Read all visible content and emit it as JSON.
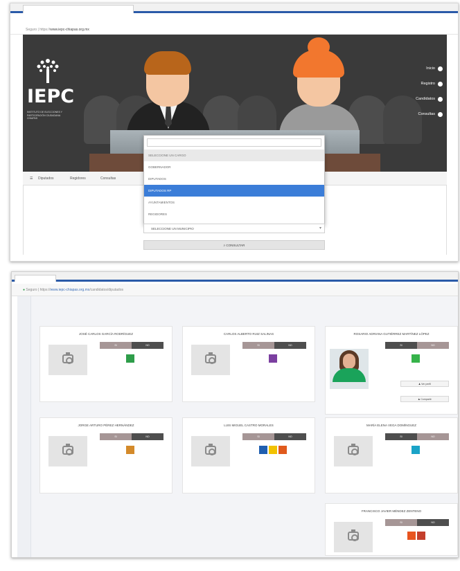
{
  "screen1": {
    "tab_title": "",
    "url": {
      "prefix": "Seguro | https://",
      "highlight": "www.iepc-chiapas.org.mx",
      "rest": ""
    },
    "logo": {
      "acronym": "IEPC",
      "subtitle": "INSTITUTO DE ELECCIONES Y PARTICIPACIÓN CIUDADANA",
      "state": "CHIAPAS"
    },
    "hero_menu": [
      "Inicio",
      "Registro",
      "Candidatos",
      "Consultas"
    ],
    "nav": [
      "Diputados",
      "Regidores",
      "Consultas"
    ],
    "dropdown": {
      "options": [
        {
          "label": "SELECCIONE UN CARGO",
          "style": "header"
        },
        {
          "label": "GOBERNADOR",
          "style": ""
        },
        {
          "label": "DIPUTADOS",
          "style": ""
        },
        {
          "label": "DIPUTADOS RP",
          "style": "selected"
        },
        {
          "label": "AYUNTAMIENTOS",
          "style": ""
        },
        {
          "label": "REGIDORES",
          "style": ""
        }
      ]
    },
    "select_municipio": "SELECCIONE UN MUNICIPIO",
    "consult_button": "CONSULTAR"
  },
  "screen2": {
    "url": {
      "prefix": "Seguro | https://",
      "highlight": "www.iepc-chiapas.org.mx",
      "rest": "/candidatos/diputados"
    },
    "vote_yes": "SI",
    "vote_no": "NO",
    "cards": [
      {
        "name": "JOSÉ CARLOS GARCÍA RODRÍGUEZ",
        "photo": "camera",
        "vote_style": "",
        "party_colors": [
          "#2e9d4a"
        ],
        "actions": []
      },
      {
        "name": "CARLOS ALBERTO RUIZ SALINAS",
        "photo": "camera",
        "vote_style": "",
        "party_colors": [
          "#7b3fa0"
        ],
        "actions": []
      },
      {
        "name": "ROSARIO ADRIANA GUTIÉRREZ MARTÍNEZ LÓPEZ",
        "photo": "person",
        "vote_style": "alt",
        "party_colors": [
          "#36b34a"
        ],
        "actions": [
          "Ver perfil",
          "Compartir"
        ]
      },
      {
        "name": "JORGE ARTURO PÉREZ HERNÁNDEZ",
        "photo": "camera",
        "vote_style": "",
        "party_colors": [
          "#d48a2a"
        ],
        "actions": []
      },
      {
        "name": "LUIS MIGUEL CASTRO MORALES",
        "photo": "camera",
        "vote_style": "",
        "party_colors": [
          "#1f5fb0",
          "#f2c200",
          "#e05a1c"
        ],
        "actions": []
      },
      {
        "name": "MARÍA ELENA VEGA DOMÍNGUEZ",
        "photo": "camera",
        "vote_style": "alt",
        "party_colors": [
          "#1aa3c7"
        ],
        "actions": []
      },
      {
        "name": "FRANCISCO JAVIER MÉNDEZ ZENTENO",
        "photo": "camera",
        "vote_style": "",
        "party_colors": [
          "#e8541f",
          "#c43e2b"
        ],
        "actions": []
      }
    ]
  }
}
